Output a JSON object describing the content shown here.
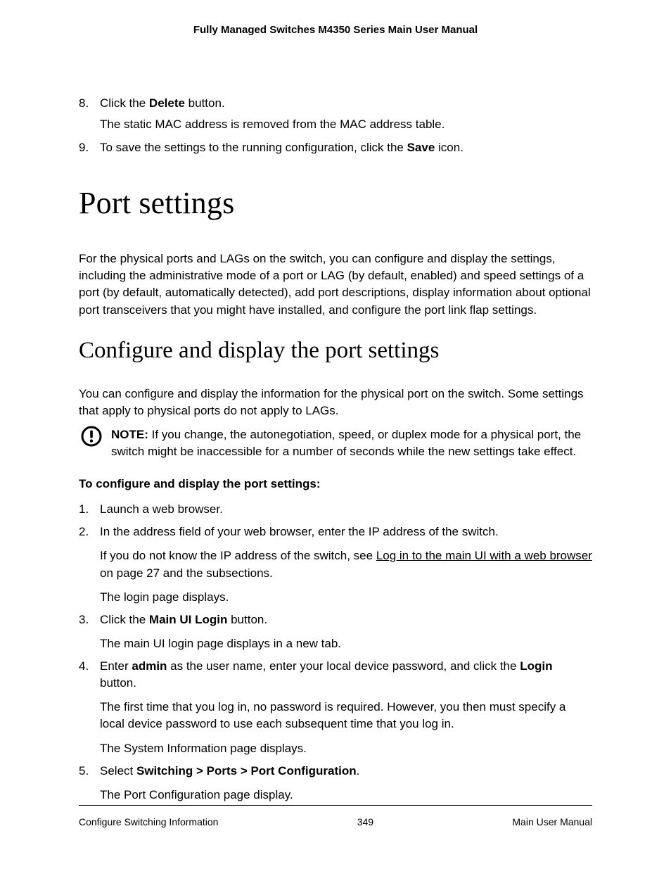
{
  "header": {
    "title": "Fully Managed Switches M4350 Series Main User Manual"
  },
  "pre_steps": [
    {
      "num": "8.",
      "lines": [
        {
          "bind": "pre_steps.0.l0",
          "html": "Click the <b>Delete</b> button."
        },
        {
          "bind": "pre_steps.0.l1",
          "html": "The static MAC address is removed from the MAC address table."
        }
      ],
      "l0": "Click the Delete button.",
      "l1": "The static MAC address is removed from the MAC address table."
    },
    {
      "num": "9.",
      "lines": [
        {
          "bind": "pre_steps.1.l0",
          "html": "To save the settings to the running configuration, click the <b>Save</b> icon."
        }
      ],
      "l0": "To save the settings to the running configuration, click the Save icon."
    }
  ],
  "section": {
    "title": "Port settings"
  },
  "section_intro": "For the physical ports and LAGs on the switch, you can configure and display the settings, including the administrative mode of a port or LAG (by default, enabled) and speed settings of a port (by default, automatically detected), add port descriptions, display information about optional port transceivers that you might have installed, and configure the port link flap settings.",
  "subsection": {
    "title": "Configure and display the port settings"
  },
  "subsection_intro": "You can configure and display the information for the physical port on the switch. Some settings that apply to physical ports do not apply to LAGs.",
  "note": {
    "label": "NOTE:",
    "text": "If you change, the autonegotiation, speed, or duplex mode for a physical port, the switch might be inaccessible for a number of seconds while the new settings take effect."
  },
  "procedure_heading": "To configure and display the port settings:",
  "proc": [
    {
      "num": "1.",
      "p0": "Launch a web browser."
    },
    {
      "num": "2.",
      "p0": "In the address field of your web browser, enter the IP address of the switch.",
      "p1_pre": "If you do not know the IP address of the switch, see ",
      "p1_link": "Log in to the main UI with a web browser",
      "p1_post": " on page 27 and the subsections.",
      "p2": "The login page displays."
    },
    {
      "num": "3.",
      "p0_pre": "Click the ",
      "p0_bold": "Main UI Login",
      "p0_post": " button.",
      "p1": "The main UI login page displays in a new tab."
    },
    {
      "num": "4.",
      "p0_pre": "Enter ",
      "p0_bold1": "admin",
      "p0_mid": " as the user name, enter your local device password, and click the ",
      "p0_bold2": "Login",
      "p0_post": " button.",
      "p1": "The first time that you log in, no password is required. However, you then must specify a local device password to use each subsequent time that you log in.",
      "p2": "The System Information page displays."
    },
    {
      "num": "5.",
      "p0_pre": "Select ",
      "p0_bold": "Switching > Ports > Port Configuration",
      "p0_post": ".",
      "p1": "The Port Configuration page display."
    }
  ],
  "footer": {
    "left": "Configure Switching Information",
    "center": "349",
    "right": "Main User Manual"
  }
}
